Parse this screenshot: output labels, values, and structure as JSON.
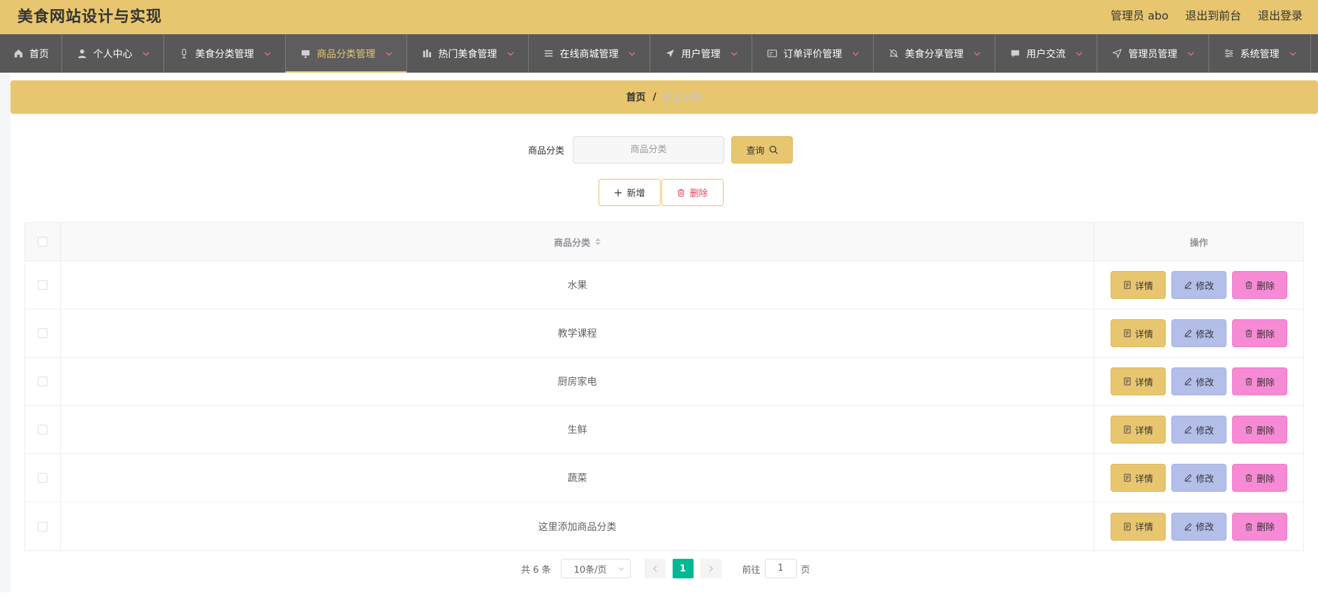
{
  "header": {
    "title": "美食网站设计与实现",
    "user_label": "管理员 abo",
    "to_front": "退出到前台",
    "logout": "退出登录"
  },
  "nav": {
    "items": [
      {
        "label": "首页",
        "icon": "home-icon"
      },
      {
        "label": "个人中心",
        "icon": "user-icon"
      },
      {
        "label": "美食分类管理",
        "icon": "mic-icon"
      },
      {
        "label": "商品分类管理",
        "icon": "monitor-icon"
      },
      {
        "label": "热门美食管理",
        "icon": "data-board-icon"
      },
      {
        "label": "在线商城管理",
        "icon": "list-icon"
      },
      {
        "label": "用户管理",
        "icon": "send-icon"
      },
      {
        "label": "订单评价管理",
        "icon": "postcard-icon"
      },
      {
        "label": "美食分享管理",
        "icon": "bell-off-icon"
      },
      {
        "label": "用户交流",
        "icon": "chat-icon"
      },
      {
        "label": "管理员管理",
        "icon": "position-icon"
      },
      {
        "label": "系统管理",
        "icon": "setting-icon"
      }
    ],
    "active_index": 3,
    "accent": "#e8c66f"
  },
  "breadcrumb": {
    "home": "首页",
    "separator": "/",
    "current": "商品分类"
  },
  "search": {
    "label": "商品分类",
    "placeholder": "商品分类",
    "query_button": "查询"
  },
  "actions": {
    "add": "新增",
    "delete": "删除"
  },
  "table": {
    "col_name": "商品分类",
    "col_ops": "操作",
    "rows": [
      "水果",
      "教学课程",
      "厨房家电",
      "生鲜",
      "蔬菜",
      "这里添加商品分类"
    ],
    "btn_detail": "详情",
    "btn_edit": "修改",
    "btn_delete": "删除"
  },
  "pagination": {
    "total": "共 6 条",
    "page_size": "10条/页",
    "current_page": "1",
    "goto_label": "前往",
    "goto_value": "1",
    "page_unit": "页"
  },
  "colors": {
    "brand_yellow": "#e8c66f",
    "nav_bg": "#585858",
    "edit_blue": "#b3bfe9",
    "delete_pink": "#f78ad5",
    "page_active": "#00b894"
  }
}
